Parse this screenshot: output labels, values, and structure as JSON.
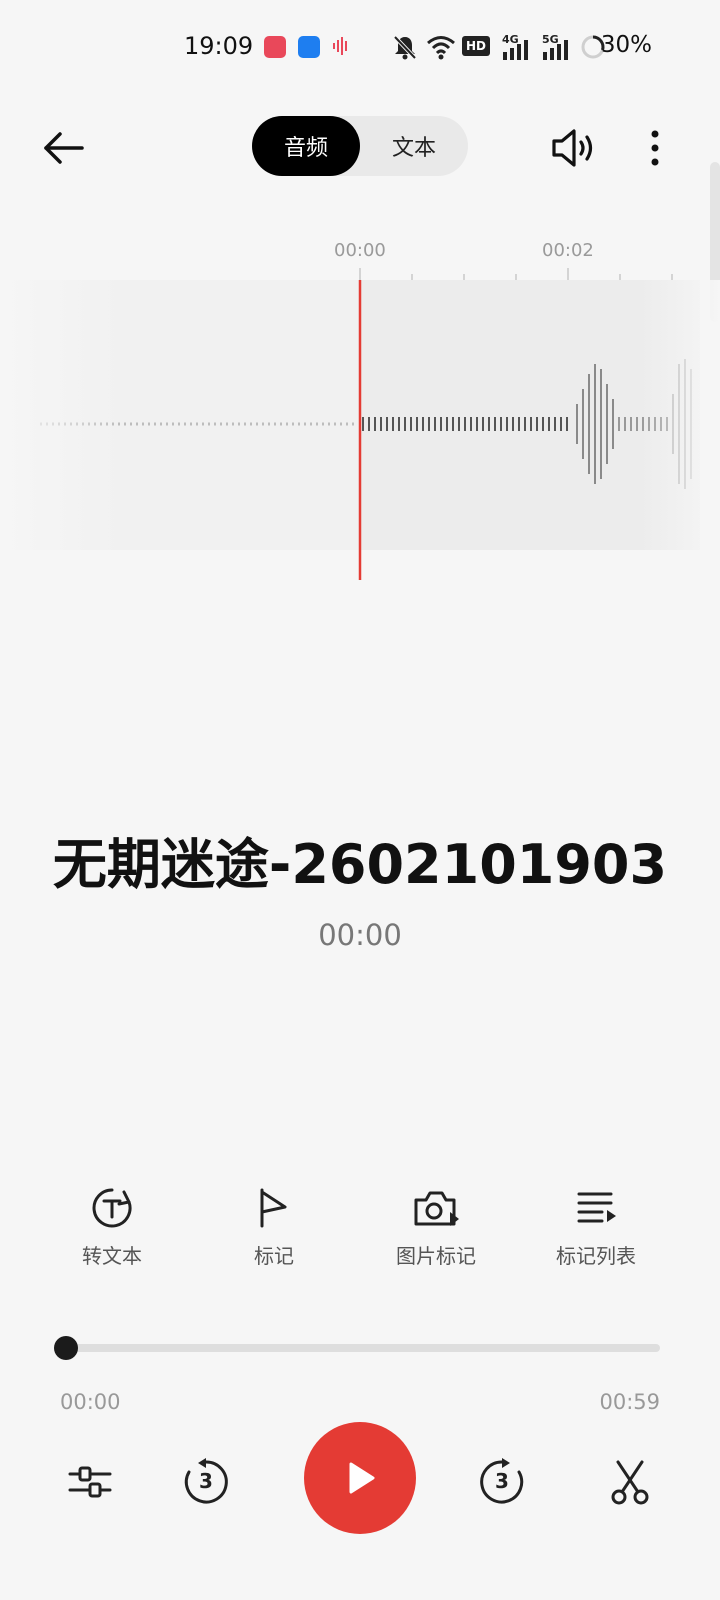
{
  "status_bar": {
    "time": "19:09",
    "battery": "30%",
    "network_4g": "4G",
    "network_5g": "5G",
    "hd": "HD"
  },
  "header": {
    "tabs": [
      {
        "label": "音频",
        "active": true
      },
      {
        "label": "文本",
        "active": false
      }
    ],
    "icons": [
      "back-arrow-icon",
      "speaker-icon",
      "more-vertical-icon"
    ]
  },
  "waveform": {
    "ruler_labels": [
      "00:00",
      "00:02"
    ],
    "playhead_color": "#e43b34"
  },
  "recording": {
    "title": "无期迷途-2602101903",
    "elapsed": "00:00"
  },
  "actions": [
    {
      "label": "转文本",
      "icon": "transcribe-text-icon"
    },
    {
      "label": "标记",
      "icon": "flag-icon"
    },
    {
      "label": "图片标记",
      "icon": "camera-mark-icon"
    },
    {
      "label": "标记列表",
      "icon": "mark-list-icon"
    }
  ],
  "progress": {
    "current": "00:00",
    "total": "00:59",
    "fraction": 0.0
  },
  "controls": {
    "rewind_seconds": "3",
    "forward_seconds": "3",
    "accent": "#e43b34"
  }
}
